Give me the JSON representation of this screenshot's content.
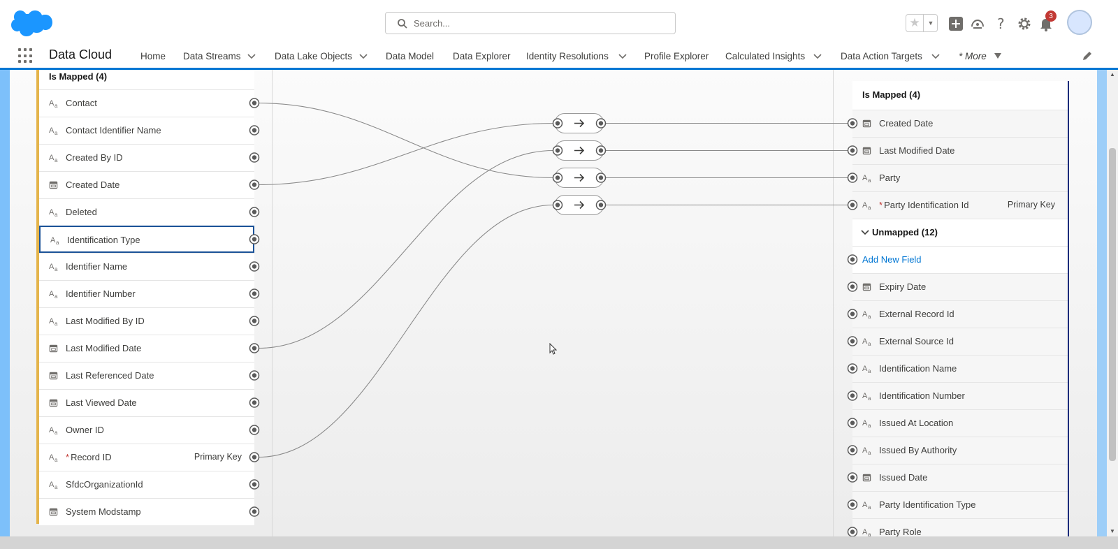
{
  "header": {
    "search_placeholder": "Search...",
    "notification_count": "3"
  },
  "nav": {
    "app_name": "Data Cloud",
    "items": [
      {
        "label": "Home"
      },
      {
        "label": "Data Streams"
      },
      {
        "label": "Data Lake Objects"
      },
      {
        "label": "Data Model"
      },
      {
        "label": "Data Explorer"
      },
      {
        "label": "Identity Resolutions"
      },
      {
        "label": "Profile Explorer"
      },
      {
        "label": "Calculated Insights"
      },
      {
        "label": "Data Action Targets"
      }
    ],
    "more_label": "* More"
  },
  "source": {
    "group_label": "Is Mapped (4)",
    "fields": [
      {
        "label": "Contact",
        "type": "text"
      },
      {
        "label": "Contact Identifier Name",
        "type": "text"
      },
      {
        "label": "Created By ID",
        "type": "text"
      },
      {
        "label": "Created Date",
        "type": "date"
      },
      {
        "label": "Deleted",
        "type": "text"
      },
      {
        "label": "Identification Type",
        "type": "text"
      },
      {
        "label": "Identifier Name",
        "type": "text"
      },
      {
        "label": "Identifier Number",
        "type": "text"
      },
      {
        "label": "Last Modified By ID",
        "type": "text"
      },
      {
        "label": "Last Modified Date",
        "type": "date"
      },
      {
        "label": "Last Referenced Date",
        "type": "date"
      },
      {
        "label": "Last Viewed Date",
        "type": "date"
      },
      {
        "label": "Owner ID",
        "type": "text"
      },
      {
        "label": "Record ID",
        "type": "text",
        "required": "*",
        "key": "Primary Key"
      },
      {
        "label": "SfdcOrganizationId",
        "type": "text"
      },
      {
        "label": "System Modstamp",
        "type": "date"
      }
    ]
  },
  "target": {
    "mapped_label": "Is Mapped (4)",
    "mapped": [
      {
        "label": "Created Date",
        "type": "date"
      },
      {
        "label": "Last Modified Date",
        "type": "date"
      },
      {
        "label": "Party",
        "type": "text"
      },
      {
        "label": "Party Identification Id",
        "type": "text",
        "required": "*",
        "key": "Primary Key"
      }
    ],
    "unmapped_label": "Unmapped (12)",
    "add_new_field": "Add New Field",
    "unmapped": [
      {
        "label": "Expiry Date",
        "type": "date"
      },
      {
        "label": "External Record Id",
        "type": "text"
      },
      {
        "label": "External Source Id",
        "type": "text"
      },
      {
        "label": "Identification Name",
        "type": "text"
      },
      {
        "label": "Identification Number",
        "type": "text"
      },
      {
        "label": "Issued At Location",
        "type": "text"
      },
      {
        "label": "Issued By Authority",
        "type": "text"
      },
      {
        "label": "Issued Date",
        "type": "date"
      },
      {
        "label": "Party Identification Type",
        "type": "text"
      },
      {
        "label": "Party Role",
        "type": "text"
      }
    ]
  },
  "mappings": [
    {
      "from": "Created Date",
      "to": "Created Date"
    },
    {
      "from": "Last Modified Date",
      "to": "Last Modified Date"
    },
    {
      "from": "Contact",
      "to": "Party"
    },
    {
      "from": "Record ID",
      "to": "Party Identification Id"
    }
  ],
  "icons": {
    "text_field": "text-type-icon",
    "date_field": "calendar-icon"
  },
  "colors": {
    "brand": "#0176d3",
    "source_accent": "#e4b44b",
    "target_accent": "#1b2b7a"
  }
}
